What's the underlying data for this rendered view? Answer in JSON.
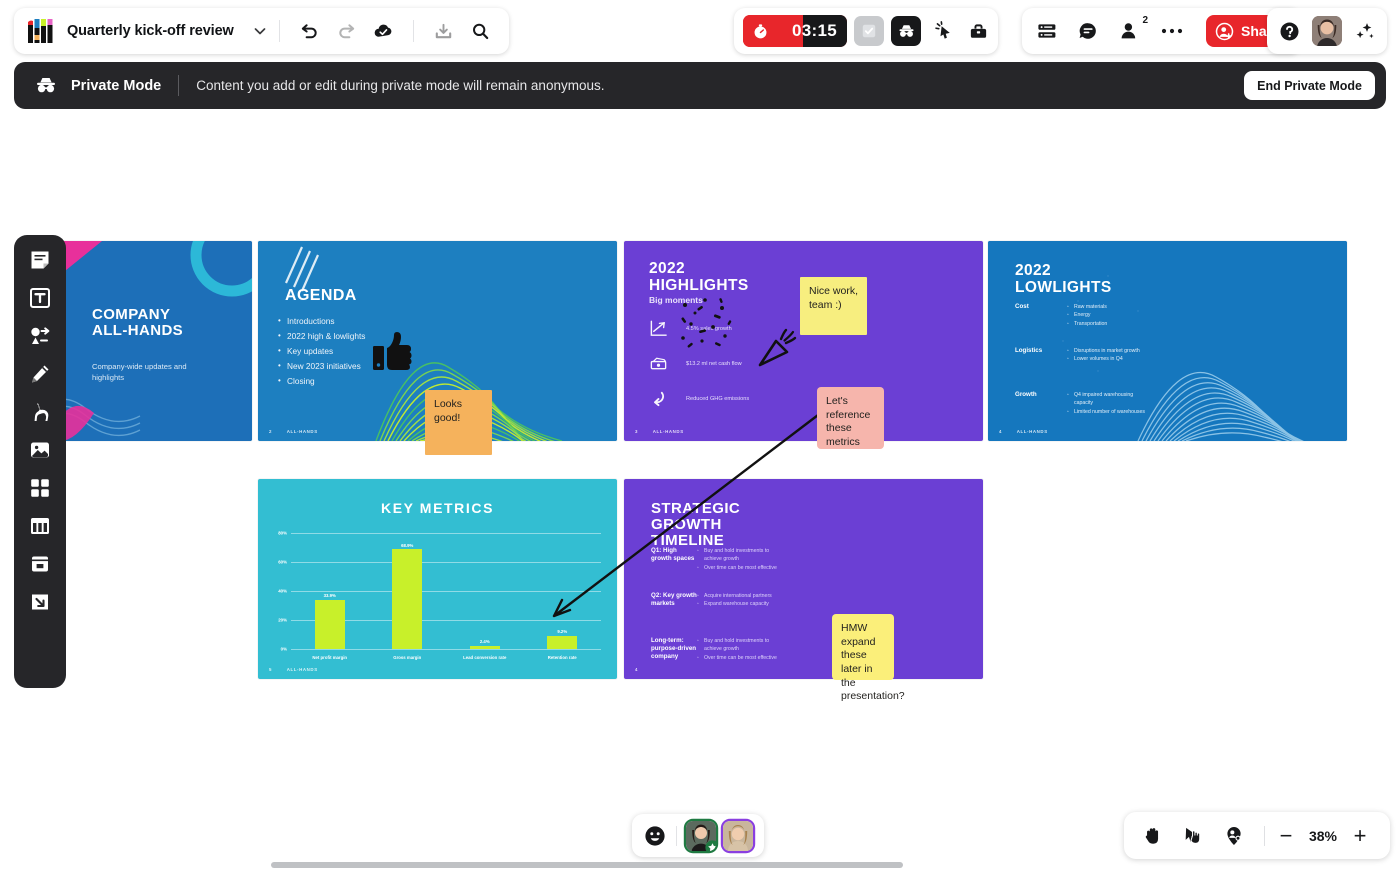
{
  "topbar": {
    "doc_title": "Quarterly kick-off review",
    "logo": "miro-logo-icon",
    "title_chevron": "chevron-down-icon",
    "undo": "undo-icon",
    "redo": "redo-icon",
    "saved": "cloud-check-icon",
    "download": "download-icon",
    "search": "search-icon",
    "timer_value": "03:15",
    "timer_icon": "stopwatch-icon",
    "vote_icon": "checkbox-icon",
    "private_icon": "incognito-glasses-icon",
    "attention_icon": "attention-cursor-icon",
    "toolkit_icon": "toolkit-icon",
    "frames_icon": "frames-panel-icon",
    "comments_icon": "comment-icon",
    "participants_icon": "person-icon",
    "participants_count": "2",
    "more_icon": "more-horizontal-icon",
    "share_label": "Share",
    "share_icon": "add-person-icon",
    "help_icon": "help-icon",
    "avatar": "user-avatar",
    "ai_icon": "sparkles-icon",
    "accent_red": "#E8262B"
  },
  "banner": {
    "icon": "incognito-glasses-icon",
    "title": "Private Mode",
    "message": "Content you add or edit during private mode will remain anonymous.",
    "end_button": "End Private Mode",
    "bg": "#262629"
  },
  "sidebar": {
    "items": [
      {
        "name": "sticky-note-tool",
        "icon": "sticky-note-icon"
      },
      {
        "name": "text-tool",
        "icon": "text-icon"
      },
      {
        "name": "shapes-tool",
        "icon": "shapes-connector-icon"
      },
      {
        "name": "pen-tool",
        "icon": "pen-icon"
      },
      {
        "name": "llama-tool",
        "icon": "llama-icon"
      },
      {
        "name": "image-tool",
        "icon": "image-icon"
      },
      {
        "name": "frame-tool",
        "icon": "grid-frame-icon"
      },
      {
        "name": "table-tool",
        "icon": "table-columns-icon"
      },
      {
        "name": "card-tool",
        "icon": "card-icon"
      },
      {
        "name": "upload-tool",
        "icon": "arrow-into-box-icon"
      }
    ]
  },
  "slides": {
    "cover": {
      "title_line1": "COMPANY",
      "title_line2": "ALL-HANDS",
      "subtitle": "Company-wide updates and highlights",
      "bg": "#1D6FB8"
    },
    "agenda": {
      "title": "AGENDA",
      "items": [
        "Introductions",
        "2022 high & lowlights",
        "Key updates",
        "New 2023 initiatives",
        "Closing"
      ],
      "page_num": "2",
      "footer": "ALL-HANDS",
      "bg": "#1D7FC0"
    },
    "highlights": {
      "title_line1": "2022",
      "title_line2": "HIGHLIGHTS",
      "subtitle": "Big moments",
      "rows": [
        {
          "icon": "line-chart-icon",
          "text": "4.5% sales growth"
        },
        {
          "icon": "cash-icon",
          "text": "$13.2 ml net cash flow"
        },
        {
          "icon": "arrow-down-curve-icon",
          "text": "Reduced GHG emissions"
        }
      ],
      "page_num": "3",
      "footer": "ALL-HANDS",
      "bg": "#6B3FD4"
    },
    "lowlights": {
      "title_line1": "2022",
      "title_line2": "LOWLIGHTS",
      "groups": [
        {
          "key": "Cost",
          "items": [
            "Raw materials",
            "Energy",
            "Transportation"
          ]
        },
        {
          "key": "Logistics",
          "items": [
            "Disruptions in market growth",
            "Lower volumes in Q4"
          ]
        },
        {
          "key": "Growth",
          "items": [
            "Q4 impaired warehousing capacity",
            "Limited number of warehouses"
          ]
        }
      ],
      "page_num": "4",
      "footer": "ALL-HANDS",
      "bg": "#1577BE"
    },
    "key_metrics": {
      "title": "KEY METRICS",
      "page_num": "5",
      "footer": "ALL-HANDS",
      "bg": "#33BED2"
    },
    "strategic": {
      "title_line1": "STRATEGIC",
      "title_line2": "GROWTH",
      "title_line3": "TIMELINE",
      "groups": [
        {
          "key": "Q1: High growth spaces",
          "items": [
            "Buy and hold investments to achieve growth",
            "Over time can be most effective"
          ]
        },
        {
          "key": "Q2: Key growth markets",
          "items": [
            "Acquire international partners",
            "Expand warehouse capacity"
          ]
        },
        {
          "key": "Long-term: purpose-driven company",
          "items": [
            "Buy and hold investments to achieve growth",
            "Over time can be most effective"
          ]
        }
      ],
      "page_num": "4",
      "bg": "#6B3FD4"
    }
  },
  "chart_data": {
    "type": "bar",
    "title": "KEY METRICS",
    "categories": [
      "Net profit margin",
      "Gross margin",
      "Lead conversion rate",
      "Retention rate"
    ],
    "values": [
      33.9,
      68.9,
      2.4,
      9.2
    ],
    "value_labels": [
      "33.9%",
      "68.9%",
      "2.4%",
      "9.2%"
    ],
    "ytick_labels": [
      "0%",
      "20%",
      "40%",
      "60%",
      "80%"
    ],
    "yticks": [
      0,
      20,
      40,
      60,
      80
    ],
    "ylim": [
      0,
      80
    ],
    "xlabel": "",
    "ylabel": "",
    "grid": true,
    "legend": "none",
    "bar_color": "#C8F02A",
    "background": "#33BED2"
  },
  "stickies": [
    {
      "name": "sticky-looks-good",
      "text": "Looks good!",
      "color": "#F5B25C"
    },
    {
      "name": "sticky-nice-work",
      "text": "Nice work, team :)",
      "color": "#F7EE7F"
    },
    {
      "name": "sticky-lets-reference",
      "text": "Let's reference these metrics",
      "color": "#F6B5AC"
    },
    {
      "name": "sticky-hmw-expand",
      "text": "HMW expand these later in the presentation?",
      "color": "#FBEF7A"
    }
  ],
  "stickers": {
    "thumbs_up": "thumbs-up-icon",
    "confetti": "confetti-icon",
    "party_popper": "party-popper-icon",
    "arrow": "arrow-connector"
  },
  "bottom": {
    "emoji_icon": "smiley-icon",
    "collaborator_1": "collaborator-avatar-1",
    "collaborator_1_badge": "star-badge-icon",
    "collaborator_2": "collaborator-avatar-2",
    "hand_icon": "hand-tool-icon",
    "select_icon": "pointer-select-icon",
    "locate_icon": "locate-users-icon",
    "zoom_out": "−",
    "zoom_level": "38%",
    "zoom_in": "+"
  }
}
